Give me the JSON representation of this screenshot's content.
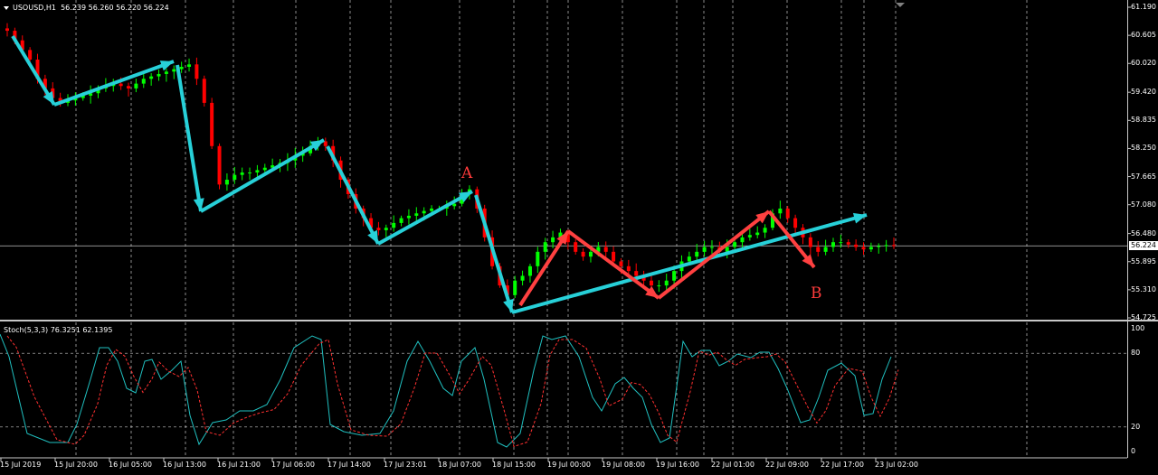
{
  "header": {
    "symbol": "USOUSD,H1",
    "ohlc": "56.239 56.260 56.220 56.224"
  },
  "stochastic": {
    "label": "Stoch(5,3,3) 76.3251 62.1395",
    "scale": [
      "100",
      "80",
      "20",
      "0"
    ]
  },
  "price_scale": [
    "61.190",
    "60.605",
    "60.020",
    "59.420",
    "58.835",
    "58.250",
    "57.665",
    "57.080",
    "56.480",
    "55.895",
    "55.310",
    "54.725"
  ],
  "current_price": "56.224",
  "time_labels": [
    "15 Jul 2019",
    "15 Jul 20:00",
    "16 Jul 05:00",
    "16 Jul 13:00",
    "16 Jul 21:00",
    "17 Jul 06:00",
    "17 Jul 14:00",
    "17 Jul 23:01",
    "18 Jul 07:00",
    "18 Jul 15:00",
    "19 Jul 00:00",
    "19 Jul 08:00",
    "19 Jul 16:00",
    "22 Jul 01:00",
    "22 Jul 09:00",
    "22 Jul 17:00",
    "23 Jul 02:00"
  ],
  "annotations": {
    "a": "A",
    "b": "B"
  },
  "colors": {
    "bull": "#00ff00",
    "bear": "#ff0000",
    "cyan_arrow": "#27d0d8",
    "red_arrow": "#ff4040",
    "stoch_main": "#20c0c0",
    "stoch_signal": "#ff3030"
  },
  "chart_data": {
    "type": "candlestick",
    "symbol": "USOUSD",
    "timeframe": "H1",
    "ylim": [
      54.725,
      61.19
    ],
    "close_series_approx": [
      60.7,
      60.5,
      60.3,
      60.1,
      59.7,
      59.5,
      59.3,
      59.2,
      59.25,
      59.3,
      59.35,
      59.4,
      59.5,
      59.55,
      59.6,
      59.55,
      59.5,
      59.6,
      59.7,
      59.75,
      59.8,
      59.85,
      59.9,
      59.95,
      60.0,
      59.7,
      59.2,
      58.3,
      57.5,
      57.6,
      57.7,
      57.75,
      57.75,
      57.8,
      57.85,
      57.9,
      57.95,
      58.0,
      58.1,
      58.15,
      58.3,
      58.4,
      58.3,
      58.0,
      57.6,
      57.3,
      57.0,
      56.8,
      56.6,
      56.55,
      56.6,
      56.7,
      56.8,
      56.85,
      56.9,
      56.95,
      57.0,
      57.0,
      57.05,
      57.1,
      57.3,
      57.4,
      57.0,
      56.4,
      55.8,
      55.4,
      55.2,
      55.5,
      55.6,
      55.8,
      56.1,
      56.3,
      56.4,
      56.5,
      56.3,
      56.1,
      56.0,
      56.1,
      56.2,
      56.1,
      55.9,
      55.8,
      55.7,
      55.6,
      55.5,
      55.4,
      55.4,
      55.5,
      55.7,
      55.9,
      56.0,
      56.1,
      56.2,
      56.2,
      56.1,
      56.2,
      56.3,
      56.4,
      56.45,
      56.5,
      56.6,
      56.9,
      57.0,
      56.8,
      56.6,
      56.4,
      56.2,
      56.1,
      56.2,
      56.3,
      56.3,
      56.25,
      56.2,
      56.15,
      56.2,
      56.22,
      56.24,
      56.22
    ]
  }
}
